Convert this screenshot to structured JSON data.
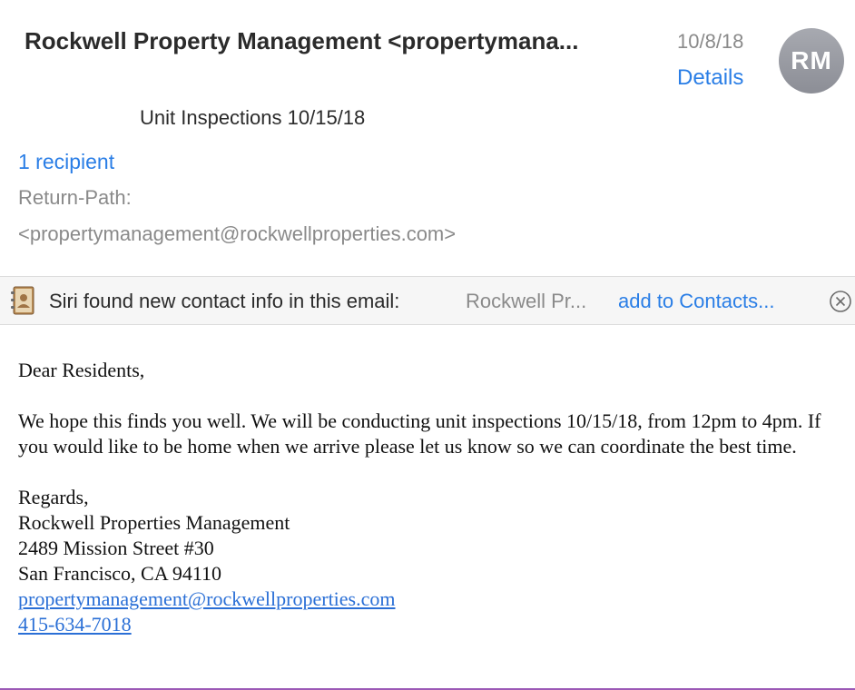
{
  "header": {
    "sender": "Rockwell Property Management <propertymana...",
    "date": "10/8/18",
    "details_label": "Details",
    "avatar_initials": "RM",
    "subject": "Unit Inspections 10/15/18",
    "recipients_label": "1 recipient",
    "return_path_label": "Return-Path:",
    "return_path_value": "<propertymanagement@rockwellproperties.com>"
  },
  "siri_banner": {
    "message": "Siri found new contact info in this email:",
    "contact_preview": "Rockwell Pr...",
    "add_label": "add to Contacts...",
    "icon": "contacts-book-icon"
  },
  "body": {
    "greeting": "Dear Residents,",
    "paragraph": "We hope this finds you well. We will be conducting unit inspections 10/15/18, from 12pm to 4pm. If you would like to be home when we arrive please let us know so we can coordinate the best time.",
    "closing": "Regards,",
    "signature_name": "Rockwell Properties Management",
    "address_line1": "2489 Mission Street #30",
    "address_line2": "San Francisco, CA 94110",
    "email": "propertymanagement@rockwellproperties.com",
    "phone": "415-634-7018"
  },
  "colors": {
    "link_blue": "#2a7ee6",
    "secondary_gray": "#8a8a8a",
    "avatar_gray": "#9a9ca3"
  }
}
